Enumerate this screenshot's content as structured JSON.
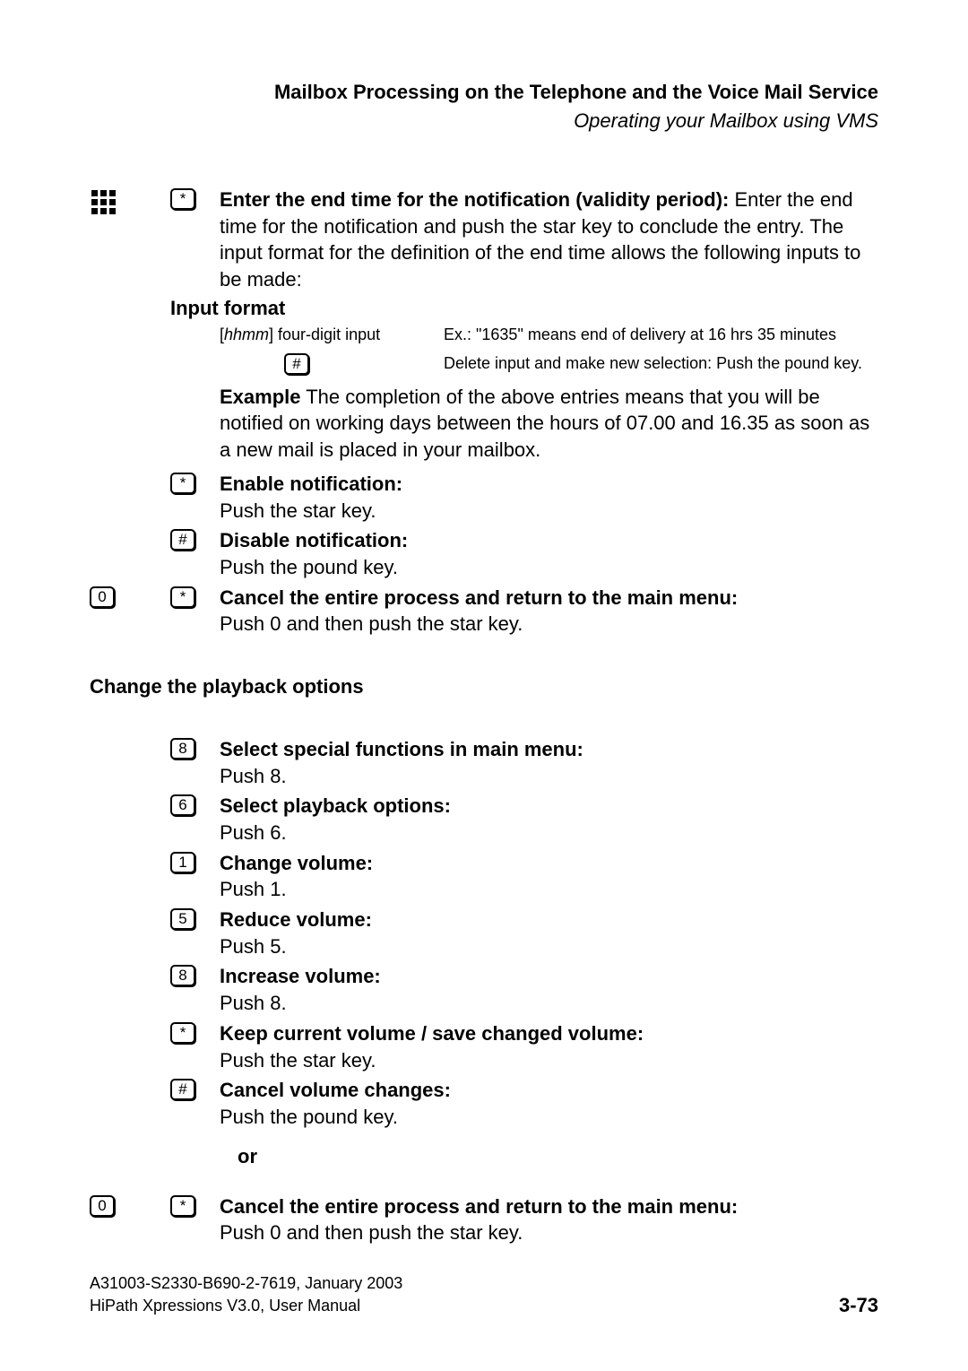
{
  "header": {
    "title": "Mailbox Processing on the Telephone and the Voice Mail Service",
    "subtitle": "Operating your Mailbox using VMS"
  },
  "step1": {
    "key": "*",
    "title": "Enter the end time for the notification (validity period):",
    "body": "Enter the end time for the notification and push the star key to conclude the entry. The input format for the definition of the end time allows the following inputs to be made:"
  },
  "input_format_label": "Input format",
  "format_row1": {
    "left_pre": "[",
    "left_hh": "hhmm",
    "left_post": "] four-digit input",
    "right": "Ex.: \"1635\" means end of delivery at 16 hrs 35 minutes"
  },
  "format_row2": {
    "key": "#",
    "right": "Delete input and make new selection: Push the pound key."
  },
  "example": {
    "label": "Example",
    "text": " The completion of the above entries means that you will be notified on working days between the hours of 07.00 and 16.35 as soon as a new mail is placed in your mailbox."
  },
  "enable": {
    "key": "*",
    "title": "Enable notification:",
    "body": "Push the star key."
  },
  "disable": {
    "key": "#",
    "title": "Disable notification:",
    "body": "Push the pound key."
  },
  "cancel1": {
    "key0": "0",
    "keystar": "*",
    "title": "Cancel the entire process and return to the main menu:",
    "body": "Push 0 and then push the star key."
  },
  "playback_heading": "Change the playback options",
  "pb1": {
    "key": "8",
    "title": "Select special functions in main menu:",
    "body": "Push 8."
  },
  "pb2": {
    "key": "6",
    "title": "Select playback options:",
    "body": "Push 6."
  },
  "pb3": {
    "key": "1",
    "title": "Change volume:",
    "body": "Push 1."
  },
  "pb4": {
    "key": "5",
    "title": "Reduce volume:",
    "body": "Push 5."
  },
  "pb5": {
    "key": "8",
    "title": "Increase volume:",
    "body": "Push 8."
  },
  "pb6": {
    "key": "*",
    "title": "Keep current volume / save changed volume:",
    "body": "Push the star key."
  },
  "pb7": {
    "key": "#",
    "title": "Cancel volume changes:",
    "body": "Push the pound key."
  },
  "or_label": "or",
  "cancel2": {
    "key0": "0",
    "keystar": "*",
    "title": "Cancel the entire process and return to the main menu:",
    "body": "Push 0 and then push the star key."
  },
  "footer": {
    "line1": "A31003-S2330-B690-2-7619, January 2003",
    "line2": "HiPath Xpressions V3.0, User Manual",
    "page": "3-73"
  }
}
